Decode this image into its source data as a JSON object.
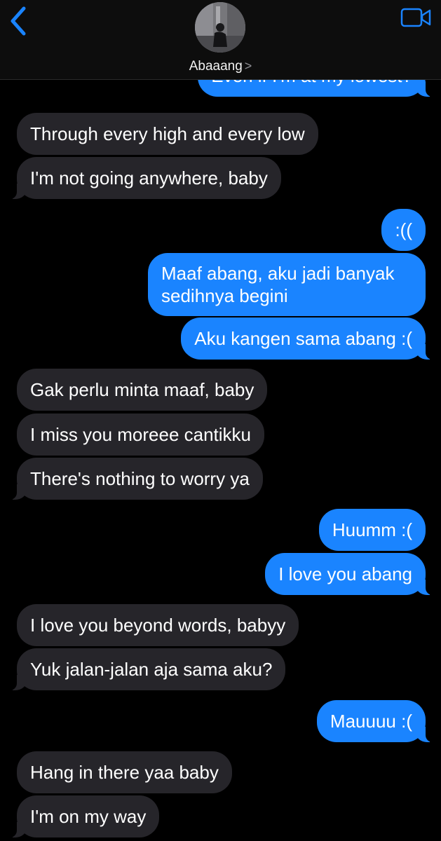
{
  "header": {
    "contact_name": "Abaaang",
    "chevron": ">",
    "back_icon": "chevron-left-icon",
    "video_icon": "video-camera-icon",
    "accent": "#1a84ff"
  },
  "messages": [
    {
      "side": "out",
      "text": "Even if I'm at my lowest?"
    },
    {
      "side": "in",
      "text": "Through every high and every low"
    },
    {
      "side": "in",
      "text": "I'm not going anywhere, baby"
    },
    {
      "side": "out",
      "text": ":(("
    },
    {
      "side": "out",
      "text": "Maaf abang, aku jadi banyak sedihnya begini"
    },
    {
      "side": "out",
      "text": "Aku kangen sama abang :("
    },
    {
      "side": "in",
      "text": "Gak perlu minta maaf, baby"
    },
    {
      "side": "in",
      "text": "I miss you moreee cantikku"
    },
    {
      "side": "in",
      "text": "There's nothing to worry ya"
    },
    {
      "side": "out",
      "text": "Huumm :("
    },
    {
      "side": "out",
      "text": "I love you abang"
    },
    {
      "side": "in",
      "text": "I love you beyond words, babyy"
    },
    {
      "side": "in",
      "text": "Yuk jalan-jalan aja sama aku?"
    },
    {
      "side": "out",
      "text": "Mauuuu :("
    },
    {
      "side": "in",
      "text": "Hang in there yaa baby"
    },
    {
      "side": "in",
      "text": "I'm on my way"
    }
  ]
}
